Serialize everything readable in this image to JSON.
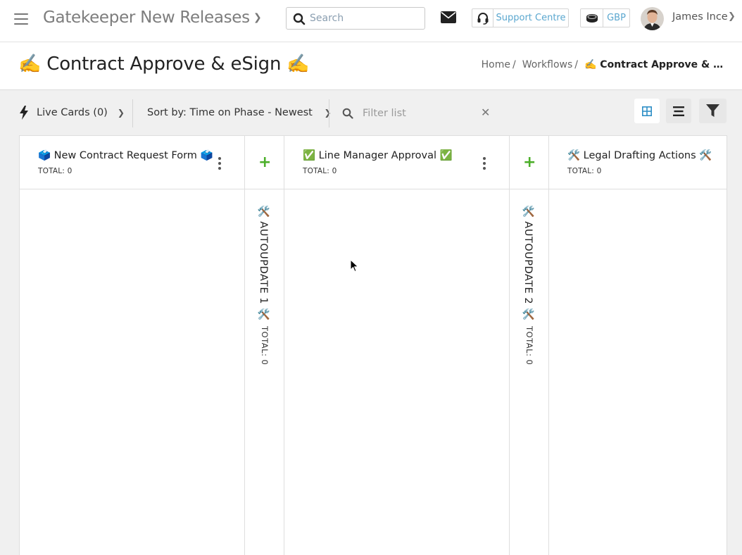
{
  "app": {
    "title": "Gatekeeper New Releases"
  },
  "topbar": {
    "search_placeholder": "Search",
    "support_label": "Support Centre",
    "currency_label": "GBP",
    "user_name": "James Ince"
  },
  "page": {
    "title": "✍️ Contract Approve & eSign ✍️",
    "breadcrumb": [
      {
        "label": "Home"
      },
      {
        "label": "Workflows"
      },
      {
        "label": "✍️ Contract Approve & eSig..."
      }
    ]
  },
  "toolbar": {
    "live_cards_label": "Live Cards (0)",
    "sort_label": "Sort by: Time on Phase - Newest",
    "filter_placeholder": "Filter list"
  },
  "board": {
    "phases": [
      {
        "name": "🗳️ New Contract Request Form 🗳️",
        "total": "TOTAL: 0"
      },
      {
        "name": "✅ Line Manager Approval ✅",
        "total": "TOTAL: 0"
      },
      {
        "name": "🛠️ Legal Drafting Actions 🛠️",
        "total": "TOTAL: 0"
      }
    ],
    "auto_steps": [
      {
        "name": "🛠️ AUTOUPDATE 1 🛠️",
        "total": "TOTAL: 0",
        "add": "+"
      },
      {
        "name": "🛠️ AUTOUPDATE 2 🛠️",
        "total": "TOTAL: 0",
        "add": "+"
      }
    ]
  },
  "colors": {
    "accent_blue": "#5aa7cf",
    "add_green": "#4caf2a",
    "grid_icon_blue": "#2f8fc6"
  }
}
